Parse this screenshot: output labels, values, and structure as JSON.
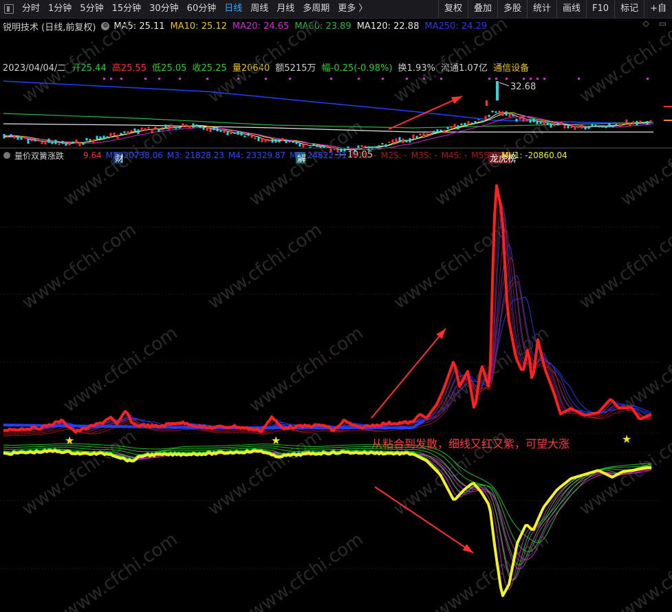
{
  "toolbar": {
    "left_items": [
      "分时",
      "1分钟",
      "5分钟",
      "15分钟",
      "30分钟",
      "60分钟",
      "日线",
      "周线",
      "月线",
      "多周期",
      "更多 〉"
    ],
    "active_index": 6,
    "right_items": [
      "复权",
      "叠加",
      "多股",
      "统计",
      "画线",
      "F10",
      "标记",
      "+自"
    ]
  },
  "header": {
    "title": "锐明技术 (日线,前复权)",
    "ma": [
      {
        "label": "MA5: 25.11",
        "color": "#e6e6e6"
      },
      {
        "label": "MA10: 25.12",
        "color": "#e8c12a"
      },
      {
        "label": "MA20: 24.65",
        "color": "#d32ad3"
      },
      {
        "label": "MA60: 23.89",
        "color": "#2ab64a"
      },
      {
        "label": "MA120: 22.88",
        "color": "#e6e6e6"
      },
      {
        "label": "MA250: 24.29",
        "color": "#2a3ae6"
      }
    ],
    "icons": [
      "diamond-icon",
      "collapse-icon"
    ]
  },
  "quote": {
    "date": "2023/04/04/二",
    "open": "开25.44",
    "high": "高25.55",
    "low": "低25.05",
    "close": "收25.25",
    "volume": "量20640",
    "amount": "额5215万",
    "change": "幅-0.25(-0.98%)",
    "turnover": "换1.93%",
    "float": "流通1.07亿",
    "industry": "通信设备"
  },
  "price_chart": {
    "high_label": "32.68",
    "low_label": "19.05",
    "markers": [
      "财",
      "解",
      "龙虎榜"
    ]
  },
  "indicator": {
    "name": "量价双簧涨跌",
    "values": [
      {
        "text": "9.64",
        "color": "#ff2a2a"
      },
      {
        "text": "M2: 20738.06",
        "color": "#2a4aff"
      },
      {
        "text": "M3: 21828.23",
        "color": "#2a4aff"
      },
      {
        "text": "M4: 23329.87",
        "color": "#2a4aff"
      },
      {
        "text": "M5: 24822.31",
        "color": "#2a4aff"
      },
      {
        "text": "M1S: -",
        "color": "#b01818"
      },
      {
        "text": "M2S: -",
        "color": "#b01818"
      },
      {
        "text": "M3S: -",
        "color": "#b01818"
      },
      {
        "text": "M4S: -",
        "color": "#b01818"
      },
      {
        "text": "M5S: -",
        "color": "#b01818"
      },
      {
        "text": "MV1: -20860.04",
        "color": "#f0f02a"
      }
    ]
  },
  "annotation": "从粘合到发散，细线又红又紫，可望大涨",
  "watermark": "www.cfchi.com",
  "colors": {
    "red": "#ff2020",
    "blue": "#2040ff",
    "yellow": "#f2f22a",
    "magenta": "#d02ad0",
    "green": "#2ad02a",
    "arrow": "#ff3030"
  }
}
